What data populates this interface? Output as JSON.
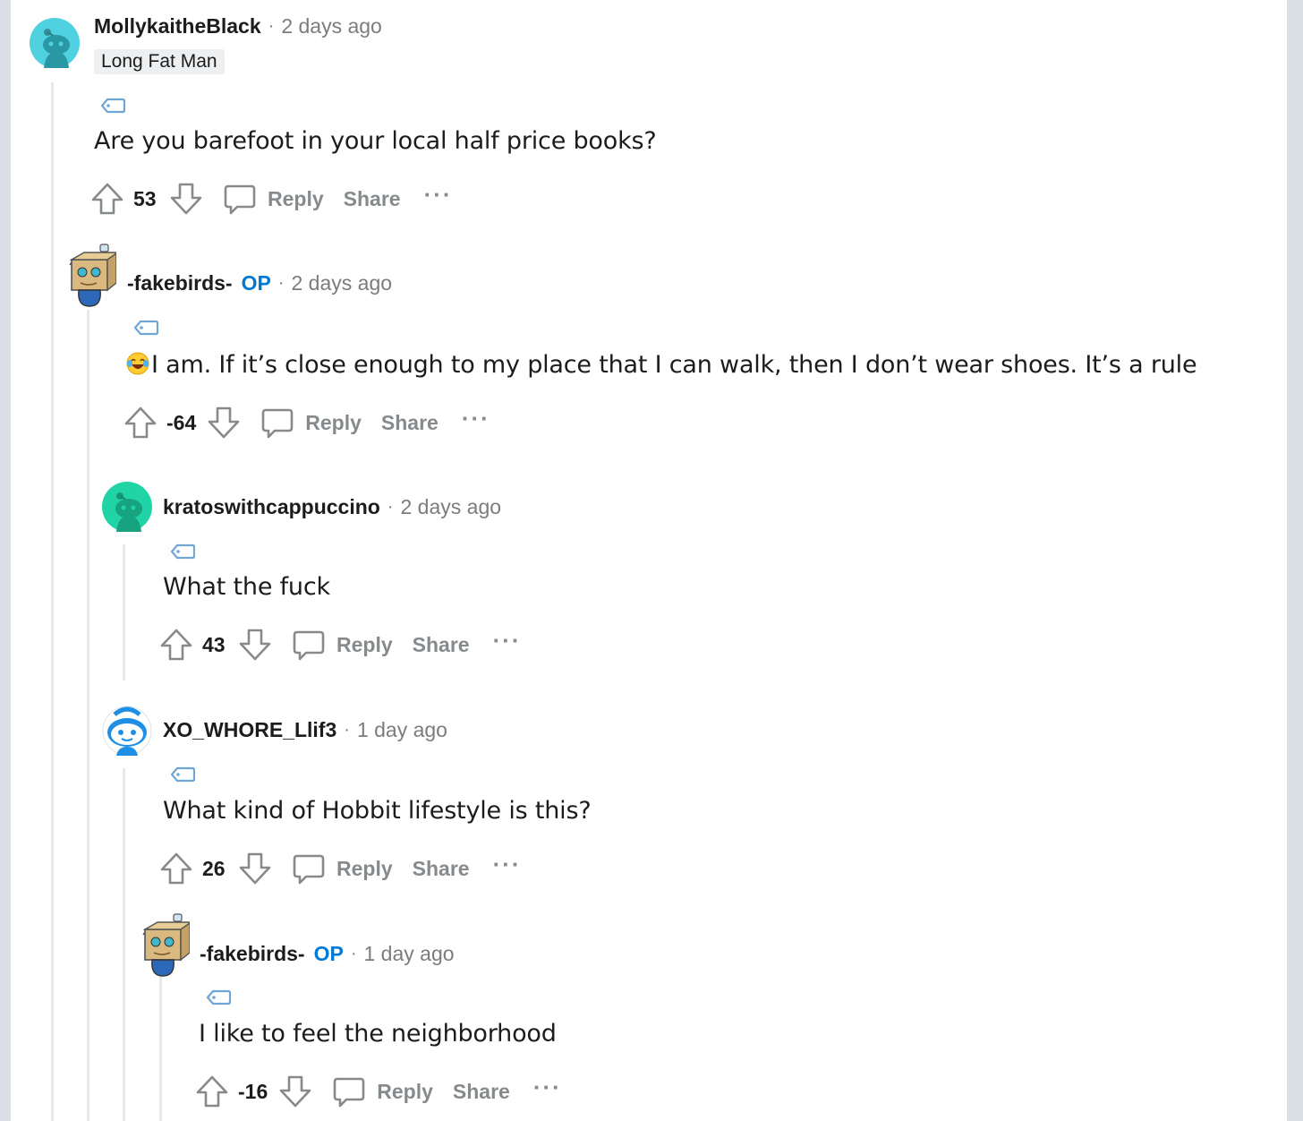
{
  "comments": [
    {
      "username": "MollykaitheBlack",
      "flair": "Long Fat Man",
      "time": "2 days ago",
      "body": "Are you barefoot in your local half price books?",
      "score": "53",
      "avatar": "snoo-teal-avatar"
    },
    {
      "username": "-fakebirds-",
      "op_badge": "OP",
      "time": "2 days ago",
      "emoji": "😂",
      "body": "I am. If it’s close enough to my place that I can walk, then I don’t wear shoes. It’s a rule",
      "score": "-64",
      "avatar": "box-robot-avatar"
    },
    {
      "username": "kratoswithcappuccino",
      "time": "2 days ago",
      "body": "What the fuck",
      "score": "43",
      "avatar": "snoo-green-avatar"
    },
    {
      "username": "XO_WHORE_Llif3",
      "time": "1 day ago",
      "body": "What kind of Hobbit lifestyle is this?",
      "score": "26",
      "avatar": "snoo-blue-face-avatar"
    },
    {
      "username": "-fakebirds-",
      "op_badge": "OP",
      "time": "1 day ago",
      "body": "I like to feel the neighborhood",
      "score": "-16",
      "avatar": "box-robot-avatar"
    }
  ],
  "actions": {
    "reply": "Reply",
    "share": "Share",
    "more": "···"
  },
  "colors": {
    "op": "#0079d3",
    "meta": "#7c7c7c",
    "action": "#878a8c",
    "thread": "#e6e8ea"
  }
}
